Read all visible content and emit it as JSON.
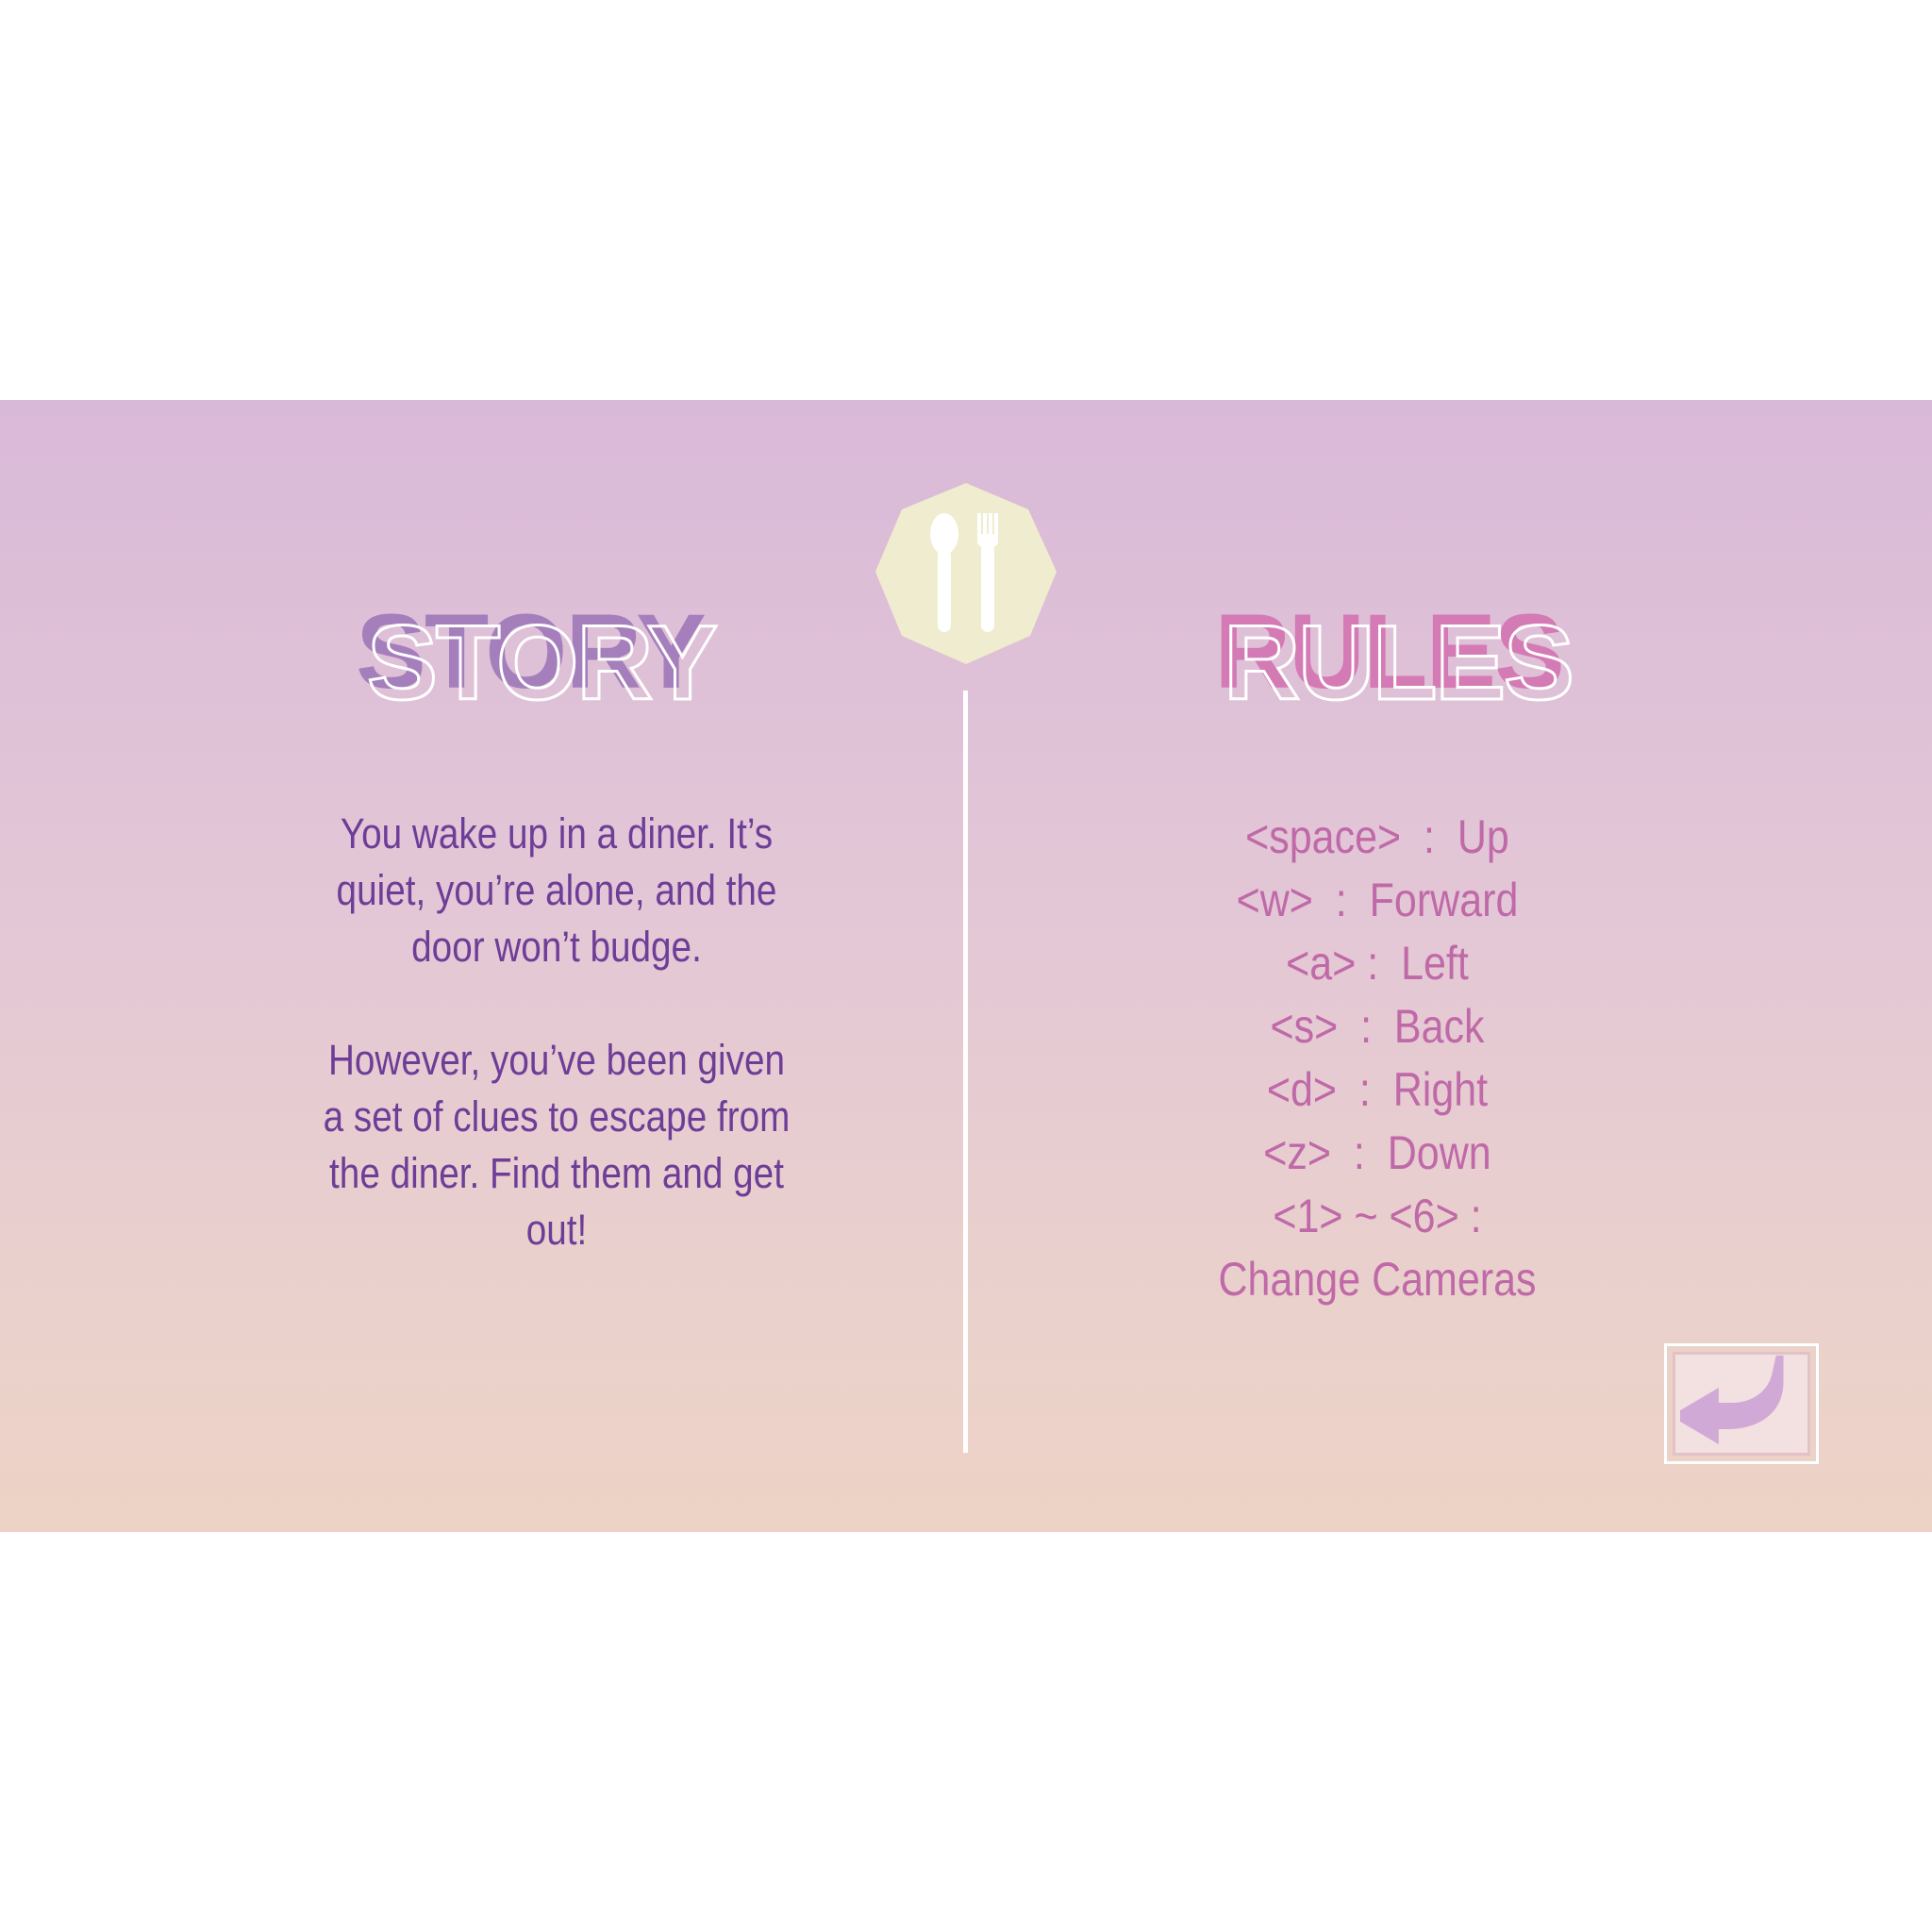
{
  "colors": {
    "story_heading": "#a57ebc",
    "rules_heading": "#d47ab4",
    "story_text": "#6e3d97",
    "rules_text": "#c069a8",
    "emblem_fill": "#f0eccf",
    "back_arrow": "#d1a9d6"
  },
  "emblem": {
    "icon": "utensils-icon"
  },
  "story": {
    "heading": "STORY",
    "paragraphs": [
      "You wake up in a diner. It’s quiet, you’re alone, and the door won’t budge.",
      "However, you’ve been given a set of clues to escape from the diner. Find them and get out!"
    ]
  },
  "rules": {
    "heading": "RULES",
    "items": [
      "<space>  :  Up",
      "<w>  :  Forward",
      "<a> :  Left",
      "<s>  :  Back",
      "<d>  :  Right",
      "<z>  :  Down",
      "<1> ~ <6> : Change Cameras"
    ]
  },
  "back_button": {
    "icon": "return-arrow-icon"
  }
}
